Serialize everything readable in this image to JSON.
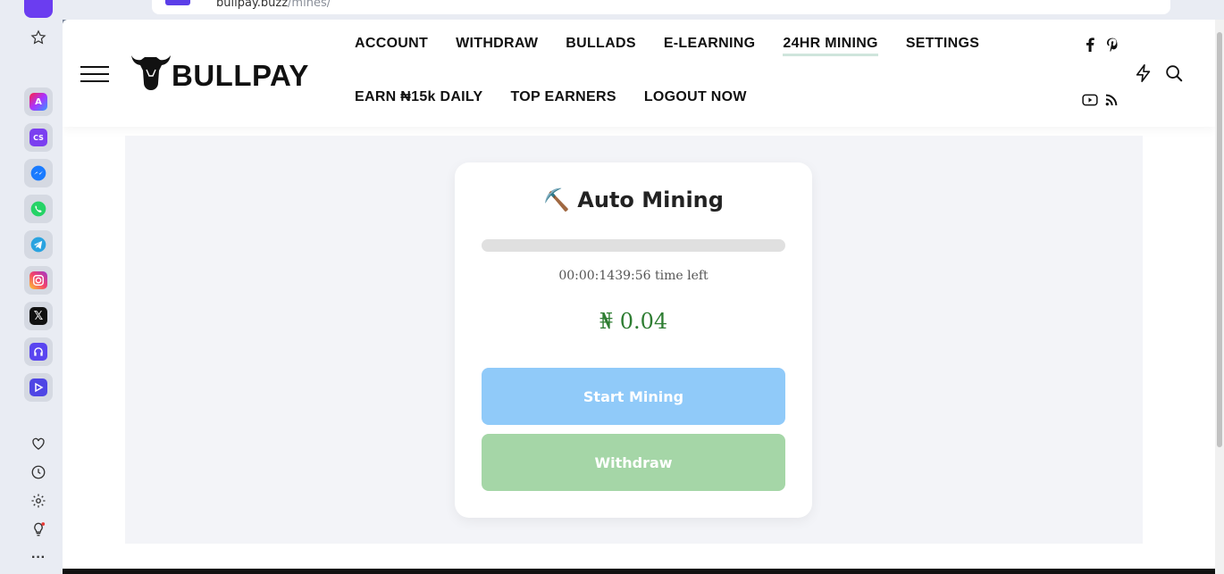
{
  "browser": {
    "url_host": "bullpay.buzz",
    "url_path": "/mines/"
  },
  "site": {
    "logo_text": "BULLPAY",
    "nav_row1": [
      "ACCOUNT",
      "WITHDRAW",
      "BULLADS",
      "E-LEARNING",
      "24HR MINING",
      "SETTINGS"
    ],
    "nav_row2": [
      "EARN ₦15k DAILY",
      "TOP EARNERS",
      "LOGOUT NOW"
    ],
    "active_nav": "24HR MINING"
  },
  "mining": {
    "icon": "⛏️",
    "title": "Auto Mining",
    "progress_percent": 0,
    "time_left": "00:00:1439:56 time left",
    "amount": "₦ 0.04",
    "start_button": "Start Mining",
    "withdraw_button": "Withdraw"
  },
  "colors": {
    "start_button": "#90caf9",
    "withdraw_button": "#a5d6a7",
    "amount": "#2e7d32",
    "progress_track": "#e0e0e0"
  },
  "icons": {
    "sidebar": [
      "aria-icon",
      "cs-icon",
      "messenger-icon",
      "whatsapp-icon",
      "telegram-icon",
      "instagram-icon",
      "x-icon",
      "music-icon",
      "player-icon"
    ],
    "sidebar_bottom": [
      "heart-icon",
      "history-icon",
      "settings-icon",
      "lightbulb-icon",
      "more-icon"
    ],
    "header": [
      "facebook-icon",
      "pinterest-icon",
      "flash-icon",
      "search-icon",
      "youtube-icon",
      "rss-icon"
    ]
  }
}
